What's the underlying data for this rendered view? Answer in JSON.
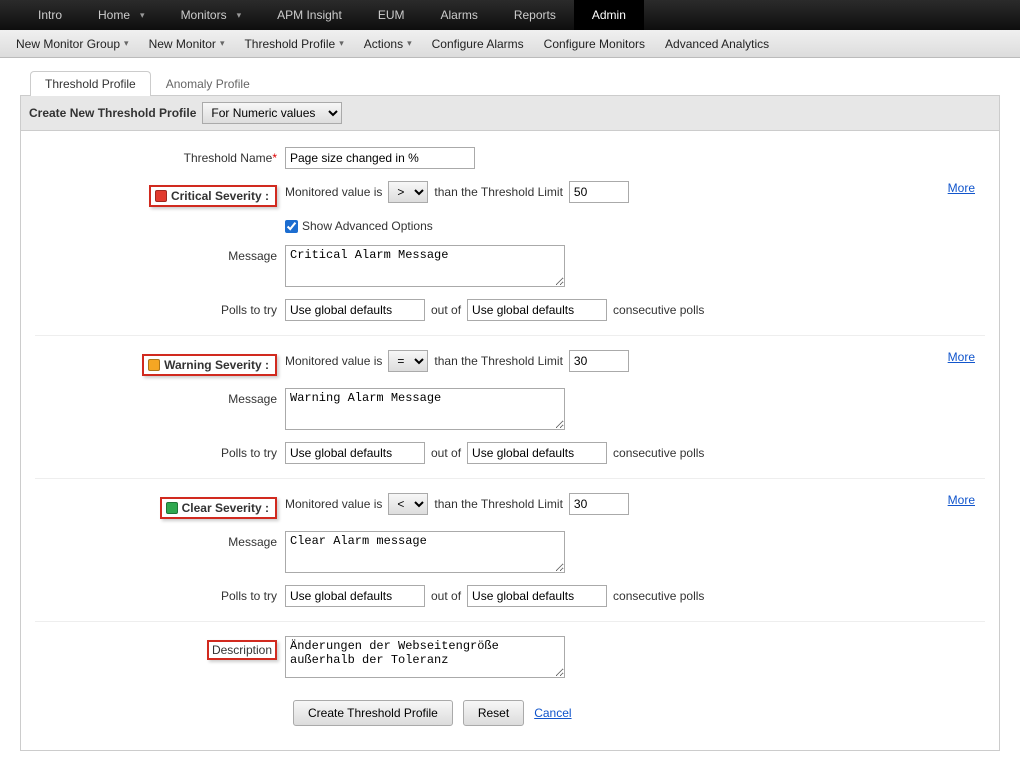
{
  "topnav": {
    "items": [
      {
        "label": "Intro"
      },
      {
        "label": "Home",
        "dropdown": true
      },
      {
        "label": "Monitors",
        "dropdown": true
      },
      {
        "label": "APM Insight"
      },
      {
        "label": "EUM"
      },
      {
        "label": "Alarms"
      },
      {
        "label": "Reports"
      },
      {
        "label": "Admin",
        "active": true
      }
    ]
  },
  "subnav": {
    "items": [
      {
        "label": "New Monitor Group",
        "dropdown": true
      },
      {
        "label": "New Monitor",
        "dropdown": true
      },
      {
        "label": "Threshold Profile",
        "dropdown": true
      },
      {
        "label": "Actions",
        "dropdown": true
      },
      {
        "label": "Configure Alarms"
      },
      {
        "label": "Configure Monitors"
      },
      {
        "label": "Advanced Analytics"
      }
    ]
  },
  "tabs": {
    "threshold": "Threshold Profile",
    "anomaly": "Anomaly Profile"
  },
  "panel": {
    "create_label": "Create New Threshold Profile",
    "type_select": "For Numeric values"
  },
  "form": {
    "threshold_name_label": "Threshold Name*",
    "threshold_name_value": "Page size changed in %",
    "monitored_value_is": "Monitored value is",
    "than_threshold": "than the Threshold Limit",
    "more": "More",
    "show_adv": "Show Advanced Options",
    "message_label": "Message",
    "polls_label": "Polls to try",
    "out_of": "out of",
    "consecutive": "consecutive polls",
    "global_default": "Use global defaults",
    "description_label": "Description",
    "create_btn": "Create Threshold Profile",
    "reset_btn": "Reset",
    "cancel_btn": "Cancel",
    "critical": {
      "title": "Critical Severity :",
      "operator": ">",
      "limit": "50",
      "message": "Critical Alarm Message"
    },
    "warning": {
      "title": "Warning Severity :",
      "operator": "=",
      "limit": "30",
      "message": "Warning Alarm Message"
    },
    "clear": {
      "title": "Clear Severity :",
      "operator": "<",
      "limit": "30",
      "message": "Clear Alarm message"
    },
    "description_value": "Änderungen der Webseitengröße außerhalb der Toleranz"
  }
}
